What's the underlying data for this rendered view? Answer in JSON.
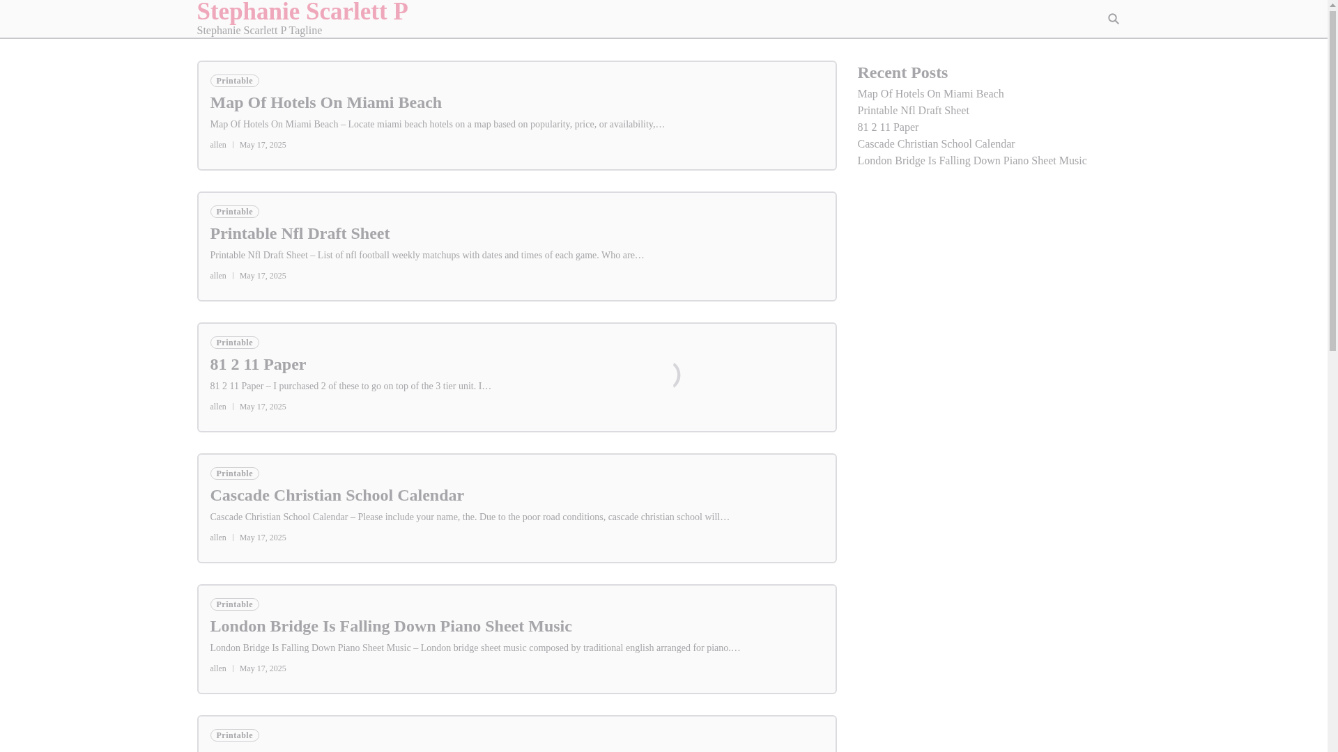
{
  "site": {
    "title": "Stephanie Scarlett P",
    "tagline": "Stephanie Scarlett P Tagline"
  },
  "posts": [
    {
      "category": "Printable",
      "title": "Map Of Hotels On Miami Beach",
      "excerpt": "Map Of Hotels On Miami Beach – Locate miami beach hotels on a map based on popularity, price, or availability,…",
      "author": "allen",
      "date": "May 17, 2025",
      "loading": false
    },
    {
      "category": "Printable",
      "title": "Printable Nfl Draft Sheet",
      "excerpt": "Printable Nfl Draft Sheet – List of nfl football weekly matchups with dates and times of each game. Who are…",
      "author": "allen",
      "date": "May 17, 2025",
      "loading": false
    },
    {
      "category": "Printable",
      "title": "81 2 11 Paper",
      "excerpt": "81 2 11 Paper – I purchased 2 of these to go on top of the 3 tier unit. I…",
      "author": "allen",
      "date": "May 17, 2025",
      "loading": true
    },
    {
      "category": "Printable",
      "title": "Cascade Christian School Calendar",
      "excerpt": "Cascade Christian School Calendar – Please include your name, the. Due to the poor road conditions, cascade christian school will…",
      "author": "allen",
      "date": "May 17, 2025",
      "loading": false
    },
    {
      "category": "Printable",
      "title": "London Bridge Is Falling Down Piano Sheet Music",
      "excerpt": "London Bridge Is Falling Down Piano Sheet Music – London bridge sheet music composed by traditional english arranged for piano.…",
      "author": "allen",
      "date": "May 17, 2025",
      "loading": false
    },
    {
      "category": "Printable"
    }
  ],
  "sidebar": {
    "heading": "Recent Posts",
    "links": [
      "Map Of Hotels On Miami Beach",
      "Printable Nfl Draft Sheet",
      "81 2 11 Paper",
      "Cascade Christian School Calendar",
      "London Bridge Is Falling Down Piano Sheet Music"
    ]
  }
}
